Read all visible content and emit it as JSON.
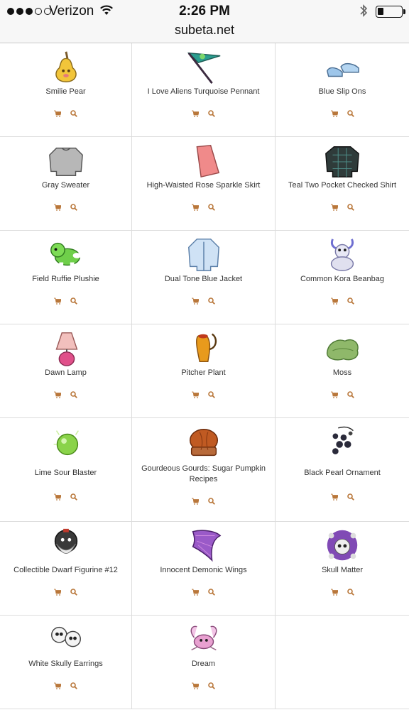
{
  "status_bar": {
    "carrier": "Verizon",
    "time": "2:26 PM",
    "signal_bars_filled": 3,
    "signal_bars_total": 5,
    "battery_level": 0.25
  },
  "browser": {
    "url": "subeta.net"
  },
  "colors": {
    "accent": "#b9773a"
  },
  "items": [
    {
      "name": "Smilie Pear",
      "icon": "pear-icon"
    },
    {
      "name": "I Love Aliens Turquoise Pennant",
      "icon": "pennant-icon"
    },
    {
      "name": "Blue Slip Ons",
      "icon": "shoes-icon"
    },
    {
      "name": "Gray Sweater",
      "icon": "sweater-icon"
    },
    {
      "name": "High-Waisted Rose Sparkle Skirt",
      "icon": "skirt-icon"
    },
    {
      "name": "Teal Two Pocket Checked Shirt",
      "icon": "shirt-icon"
    },
    {
      "name": "Field Ruffie Plushie",
      "icon": "plushie-icon"
    },
    {
      "name": "Dual Tone Blue Jacket",
      "icon": "jacket-icon"
    },
    {
      "name": "Common Kora Beanbag",
      "icon": "beanbag-icon"
    },
    {
      "name": "Dawn Lamp",
      "icon": "lamp-icon"
    },
    {
      "name": "Pitcher Plant",
      "icon": "plant-icon"
    },
    {
      "name": "Moss",
      "icon": "moss-icon"
    },
    {
      "name": "Lime Sour Blaster",
      "icon": "candy-icon"
    },
    {
      "name": "Gourdeous Gourds: Sugar Pumpkin Recipes",
      "icon": "book-icon"
    },
    {
      "name": "Black Pearl Ornament",
      "icon": "ornament-icon"
    },
    {
      "name": "Collectible Dwarf Figurine #12",
      "icon": "figurine-icon"
    },
    {
      "name": "Innocent Demonic Wings",
      "icon": "wings-icon"
    },
    {
      "name": "Skull Matter",
      "icon": "skull-icon"
    },
    {
      "name": "White Skully Earrings",
      "icon": "earrings-icon"
    },
    {
      "name": "Dream",
      "icon": "dream-icon"
    }
  ]
}
